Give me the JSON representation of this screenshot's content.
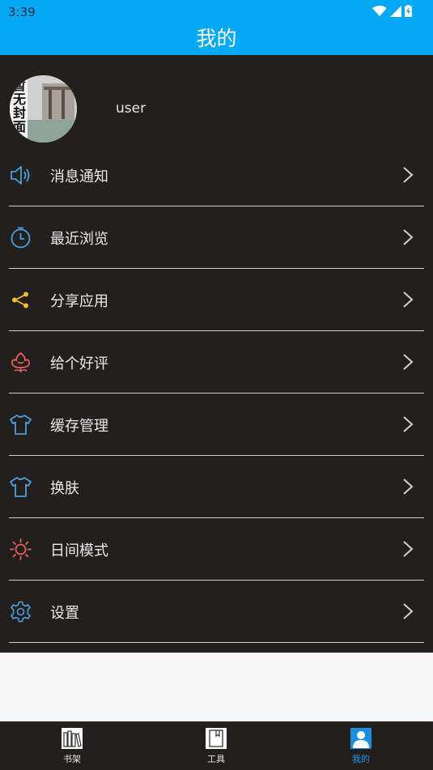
{
  "status": {
    "time": "3:39"
  },
  "header": {
    "title": "我的"
  },
  "profile": {
    "username": "user",
    "avatar_text": [
      "暂",
      "无",
      "封",
      "面"
    ]
  },
  "menu": [
    {
      "label": "消息通知",
      "icon": "speaker-icon"
    },
    {
      "label": "最近浏览",
      "icon": "timer-icon"
    },
    {
      "label": "分享应用",
      "icon": "share-icon"
    },
    {
      "label": "给个好评",
      "icon": "flower-icon"
    },
    {
      "label": "缓存管理",
      "icon": "shirt-icon"
    },
    {
      "label": "换肤",
      "icon": "shirt-icon"
    },
    {
      "label": "日间模式",
      "icon": "sun-icon"
    },
    {
      "label": "设置",
      "icon": "gear-icon"
    }
  ],
  "tabs": [
    {
      "label": "书架",
      "icon": "bookshelf-icon",
      "active": false
    },
    {
      "label": "工具",
      "icon": "book-icon",
      "active": false
    },
    {
      "label": "我的",
      "icon": "user-icon",
      "active": true
    }
  ],
  "colors": {
    "primary": "#03a9f4",
    "background_dark": "#221f1d",
    "active_tab": "#2196f3"
  }
}
